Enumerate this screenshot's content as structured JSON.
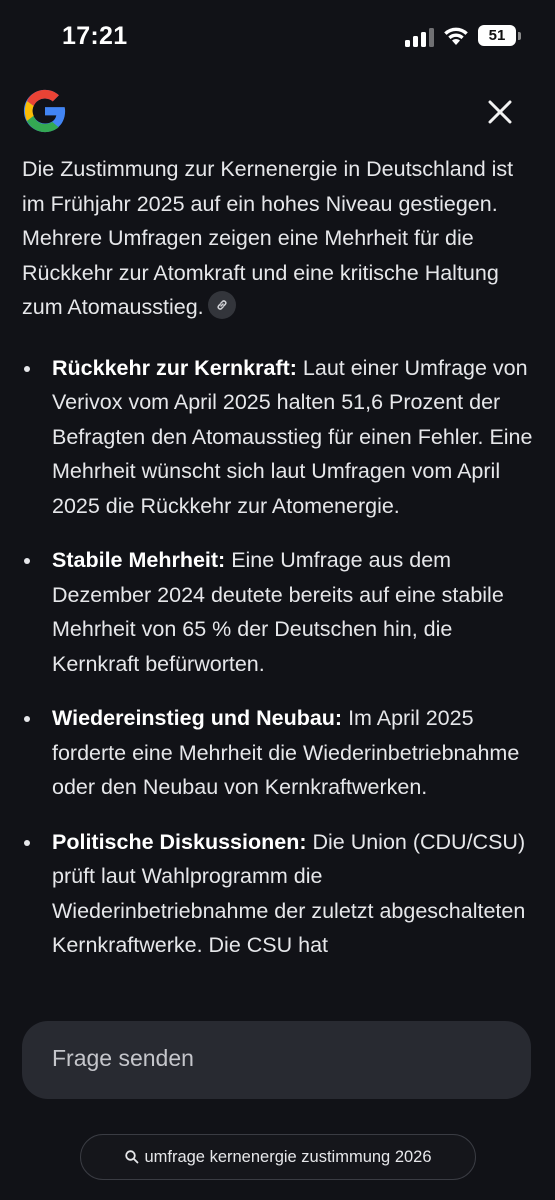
{
  "status_bar": {
    "time": "17:21",
    "battery": "51"
  },
  "header": {
    "logo_icon": "google-g-icon",
    "close_icon": "close-icon"
  },
  "answer": {
    "intro": "Die Zustimmung zur Kernenergie in Deutschland ist im Frühjahr 2025 auf ein hohes Niveau gestiegen. Mehrere Umfragen zeigen eine Mehrheit für die Rückkehr zur Atomkraft und eine kritische Haltung zum Atomausstieg.",
    "bullets": [
      {
        "title": "Rückkehr zur Kernkraft:",
        "text": " Laut einer Umfrage von Verivox vom April 2025 halten 51,6 Prozent der Befragten den Atomausstieg für einen Fehler. Eine Mehrheit wünscht sich laut Umfragen vom April 2025 die Rückkehr zur Atomenergie."
      },
      {
        "title": "Stabile Mehrheit:",
        "text": " Eine Umfrage aus dem Dezember 2024 deutete bereits auf eine stabile Mehrheit von 65 % der Deutschen hin, die Kernkraft befürworten."
      },
      {
        "title": "Wiedereinstieg und Neubau:",
        "text": " Im April 2025 forderte eine Mehrheit die Wiederinbetriebnahme oder den Neubau von Kernkraftwerken."
      },
      {
        "title": "Politische Diskussionen:",
        "text": " Die Union (CDU/CSU) prüft laut Wahlprogramm die Wiederinbetriebnahme der zuletzt abgeschalteten Kernkraftwerke. Die CSU hat"
      }
    ]
  },
  "ask": {
    "placeholder": "Frage senden"
  },
  "suggestion": {
    "query": "umfrage kernenergie zustimmung 2026"
  },
  "colors": {
    "background": "#111217",
    "input_background": "#282a31",
    "text": "#e6e7ea"
  }
}
